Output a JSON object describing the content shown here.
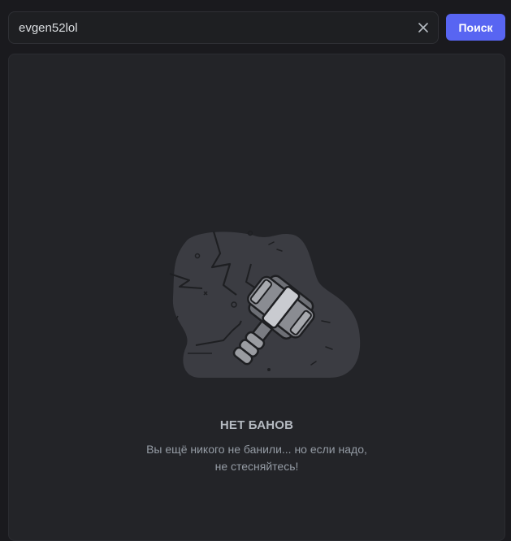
{
  "search": {
    "value": "evgen52lol",
    "placeholder": "",
    "button_label": "Поиск"
  },
  "empty_state": {
    "illustration": "ban-hammer-icon",
    "title": "НЕТ БАНОВ",
    "description_line1": "Вы ещё никого не банили... но если надо,",
    "description_line2": "не стесняйтесь!"
  },
  "colors": {
    "background": "#1a1a1e",
    "panel": "#232428",
    "accent": "#5865f2",
    "title_text": "#b5bac1",
    "muted_text": "#949ba4"
  }
}
